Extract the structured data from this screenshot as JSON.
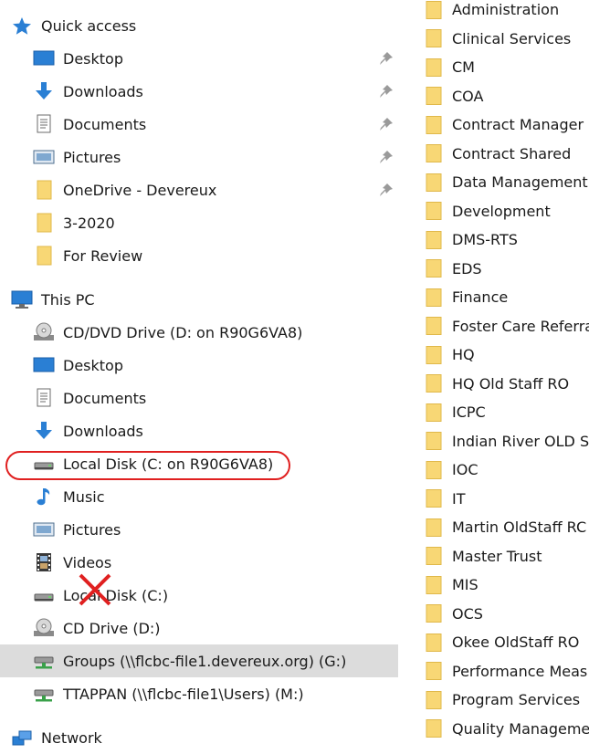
{
  "quick_access": {
    "title": "Quick access",
    "items": [
      {
        "label": "Desktop"
      },
      {
        "label": "Downloads"
      },
      {
        "label": "Documents"
      },
      {
        "label": "Pictures"
      },
      {
        "label": "OneDrive - Devereux"
      },
      {
        "label": "3-2020"
      },
      {
        "label": "For Review"
      }
    ]
  },
  "this_pc": {
    "title": "This PC",
    "items": [
      {
        "label": "CD/DVD Drive (D: on R90G6VA8)"
      },
      {
        "label": "Desktop"
      },
      {
        "label": "Documents"
      },
      {
        "label": "Downloads"
      },
      {
        "label": "Local Disk (C: on R90G6VA8)"
      },
      {
        "label": "Music"
      },
      {
        "label": "Pictures"
      },
      {
        "label": "Videos"
      },
      {
        "label": "Local Disk (C:)"
      },
      {
        "label": "CD Drive (D:)"
      },
      {
        "label": "Groups (\\\\flcbc-file1.devereux.org) (G:)"
      },
      {
        "label": "TTAPPAN (\\\\flcbc-file1\\Users) (M:)"
      }
    ]
  },
  "network": {
    "title": "Network"
  },
  "folders": [
    "Administration",
    "Clinical Services",
    "CM",
    "COA",
    "Contract Manager",
    "Contract Shared",
    "Data Management",
    "Development",
    "DMS-RTS",
    "EDS",
    "Finance",
    "Foster Care Referra",
    "HQ",
    "HQ Old Staff RO",
    "ICPC",
    "Indian River OLD S",
    "IOC",
    "IT",
    "Martin OldStaff RC",
    "Master Trust",
    "MIS",
    "OCS",
    "Okee OldStaff RO",
    "Performance Meas",
    "Program Services",
    "Quality Manageme"
  ],
  "colors": {
    "folder": "#f8d775",
    "folder_edge": "#e0b84a",
    "annotation": "#e02020",
    "selected_bg": "#dcdcdc"
  }
}
